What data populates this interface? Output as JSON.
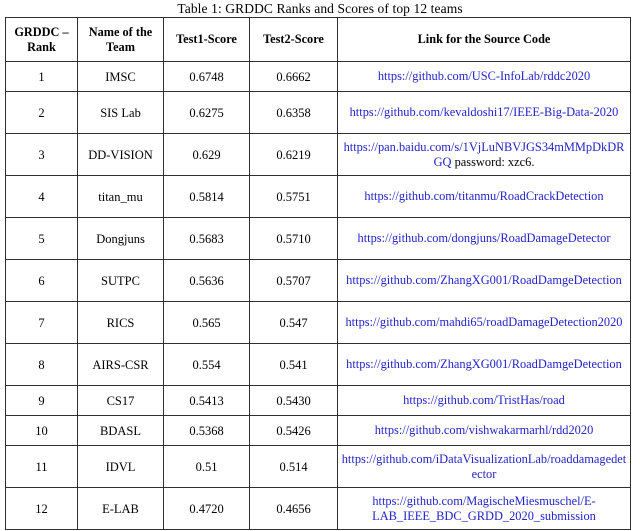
{
  "caption": "Table 1: GRDDC Ranks and Scores of top 12 teams",
  "table": {
    "headers": [
      "GRDDC – Rank",
      "Name of the Team",
      "Test1-Score",
      "Test2-Score",
      "Link for the Source Code"
    ],
    "rows": [
      {
        "rank": "1",
        "team": "IMSC",
        "test1": "0.6748",
        "test2": "0.6662",
        "link": "https://github.com/USC-InfoLab/rddc2020",
        "link_suffix": "",
        "two_line": false
      },
      {
        "rank": "2",
        "team": "SIS Lab",
        "test1": "0.6275",
        "test2": "0.6358",
        "link": "https://github.com/kevaldoshi17/IEEE-Big-Data-2020",
        "link_suffix": "",
        "two_line": true
      },
      {
        "rank": "3",
        "team": "DD-VISION",
        "test1": "0.629",
        "test2": "0.6219",
        "link": "https://pan.baidu.com/s/1VjLuNBVJGS34mMMpDkDRGQ",
        "link_suffix": "  password: xzc6.",
        "two_line": true
      },
      {
        "rank": "4",
        "team": "titan_mu",
        "test1": "0.5814",
        "test2": "0.5751",
        "link": "https://github.com/titanmu/RoadCrackDetection",
        "link_suffix": "",
        "two_line": true
      },
      {
        "rank": "5",
        "team": "Dongjuns",
        "test1": "0.5683",
        "test2": "0.5710",
        "link": "https://github.com/dongjuns/RoadDamageDetector",
        "link_suffix": "",
        "two_line": true
      },
      {
        "rank": "6",
        "team": "SUTPC",
        "test1": "0.5636",
        "test2": "0.5707",
        "link": "https://github.com/ZhangXG001/RoadDamgeDetection",
        "link_suffix": "",
        "two_line": true
      },
      {
        "rank": "7",
        "team": "RICS",
        "test1": "0.565",
        "test2": "0.547",
        "link": "https://github.com/mahdi65/roadDamageDetection2020",
        "link_suffix": "",
        "two_line": true
      },
      {
        "rank": "8",
        "team": "AIRS-CSR",
        "test1": "0.554",
        "test2": "0.541",
        "link": "https://github.com/ZhangXG001/RoadDamgeDetection",
        "link_suffix": "",
        "two_line": true
      },
      {
        "rank": "9",
        "team": "CS17",
        "test1": "0.5413",
        "test2": "0.5430",
        "link": "https://github.com/TristHas/road",
        "link_suffix": "",
        "two_line": false
      },
      {
        "rank": "10",
        "team": "BDASL",
        "test1": "0.5368",
        "test2": "0.5426",
        "link": "https://github.com/vishwakarmarhl/rdd2020",
        "link_suffix": "",
        "two_line": false
      },
      {
        "rank": "11",
        "team": "IDVL",
        "test1": "0.51",
        "test2": "0.514",
        "link": "https://github.com/iDataVisualizationLab/roaddamagedetector",
        "link_suffix": "",
        "two_line": true
      },
      {
        "rank": "12",
        "team": "E-LAB",
        "test1": "0.4720",
        "test2": "0.4656",
        "link": "https://github.com/MagischeMiesmuschel/E-LAB_IEEE_BDC_GRDD_2020_submission",
        "link_suffix": "",
        "two_line": true
      }
    ]
  },
  "colors": {
    "link": "#2323cc",
    "text": "#000000",
    "border": "#303030"
  }
}
